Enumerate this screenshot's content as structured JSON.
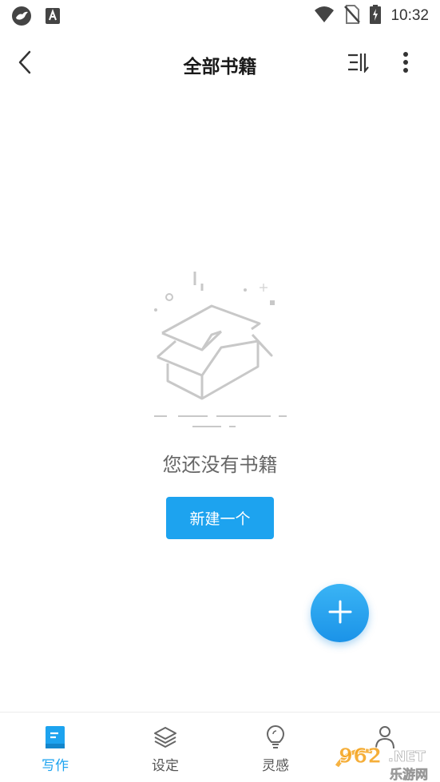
{
  "status_bar": {
    "time": "10:32",
    "icons": [
      "bird-logo-icon",
      "a-badge-icon",
      "wifi-icon",
      "no-sim-icon",
      "battery-charging-icon"
    ]
  },
  "app_bar": {
    "title": "全部书籍",
    "back_icon": "chevron-left-icon",
    "sort_icon": "sort-icon",
    "more_icon": "more-vertical-icon"
  },
  "empty_state": {
    "illustration": "open-box-icon",
    "message": "您还没有书籍",
    "create_label": "新建一个"
  },
  "fab": {
    "icon": "plus-icon"
  },
  "bottom_nav": {
    "items": [
      {
        "label": "写作",
        "icon": "book-icon",
        "active": true
      },
      {
        "label": "设定",
        "icon": "layers-icon",
        "active": false
      },
      {
        "label": "灵感",
        "icon": "lightbulb-icon",
        "active": false
      },
      {
        "label": "",
        "icon": "person-icon",
        "active": false
      }
    ]
  },
  "watermark": {
    "text": "962.NET",
    "subtext": "乐游网"
  },
  "colors": {
    "accent": "#1da3ef",
    "fab": "#2aa5ef",
    "text_primary": "#1a1a1a",
    "text_secondary": "#666666"
  }
}
